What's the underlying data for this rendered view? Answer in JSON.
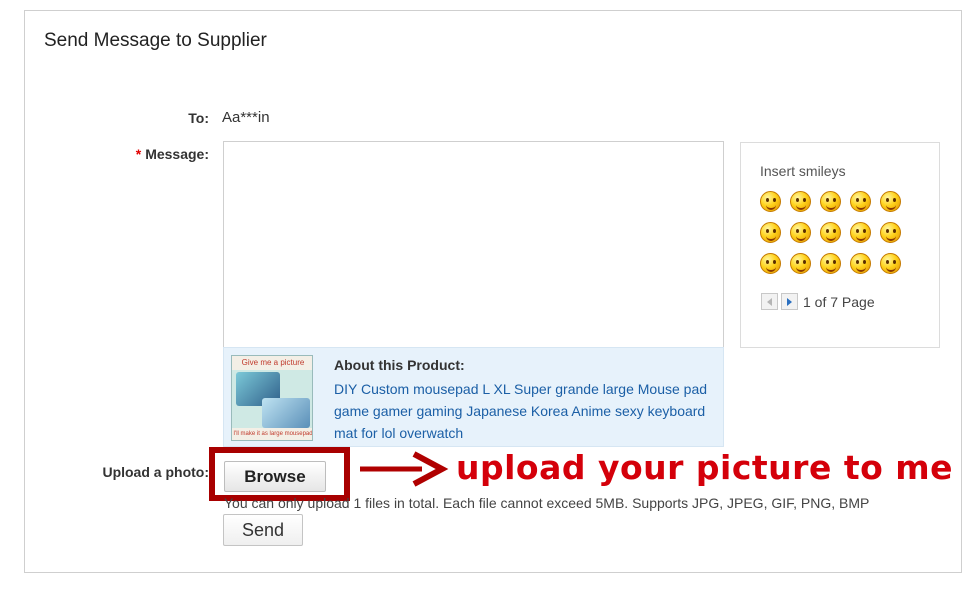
{
  "form": {
    "title": "Send Message to Supplier",
    "to_label": "To:",
    "to_value": "Aa***in",
    "message_required_mark": "*",
    "message_label": "Message:",
    "message_value": "",
    "upload_label": "Upload a photo:",
    "browse_label": "Browse",
    "upload_note": "You can only upload 1 files in total. Each file cannot exceed 5MB. Supports JPG, JPEG, GIF, PNG, BMP",
    "send_label": "Send"
  },
  "product": {
    "heading": "About this Product:",
    "title": "DIY Custom mousepad L XL Super grande large Mouse pad game gamer gaming Japanese Korea Anime sexy keyboard mat for lol overwatch",
    "thumb_top_text": "Give me a picture",
    "thumb_bottom_text": "I'll make it as large mousepad"
  },
  "smileys": {
    "title": "Insert smileys",
    "icons": [
      "smile-icon",
      "laugh-icon",
      "wink-icon",
      "blush-icon",
      "giggle-icon",
      "shout-icon",
      "grin-icon",
      "kiss-icon",
      "shy-icon",
      "crab-icon",
      "tongue-icon",
      "tease-icon",
      "squint-icon",
      "surprised-icon",
      "kissing-heart-icon"
    ],
    "page_text": "1 of 7 Page"
  },
  "annotation": {
    "text": "upload your picture to me",
    "color": "#d4000a",
    "box_color": "#a80000"
  }
}
